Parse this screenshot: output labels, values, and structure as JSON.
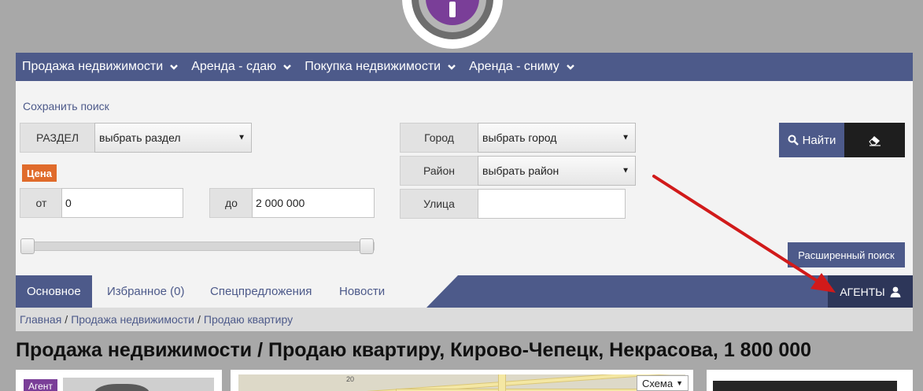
{
  "nav": {
    "items": [
      {
        "label": "Продажа недвижимости"
      },
      {
        "label": "Аренда - сдаю"
      },
      {
        "label": "Покупка недвижимости"
      },
      {
        "label": "Аренда - сниму"
      }
    ]
  },
  "search": {
    "save_link": "Сохранить поиск",
    "section_label": "РАЗДЕЛ",
    "section_value": "выбрать раздел",
    "city_label": "Город",
    "city_value": "выбрать город",
    "district_label": "Район",
    "district_value": "выбрать район",
    "street_label": "Улица",
    "street_value": "",
    "price_label": "Цена",
    "from_label": "от",
    "from_value": "0",
    "to_label": "до",
    "to_value": "2 000 000",
    "find_label": "Найти",
    "advanced_label": "Расширенный поиск"
  },
  "tabs": {
    "items": [
      {
        "label": "Основное"
      },
      {
        "label": "Избранное (0)"
      },
      {
        "label": "Спецпредложения"
      },
      {
        "label": "Новости"
      }
    ],
    "agents_label": "АГЕНТЫ"
  },
  "breadcrumb": {
    "items": [
      "Главная",
      "Продажа недвижимости",
      "Продаю квартиру"
    ],
    "separator": "/"
  },
  "page": {
    "title": "Продажа недвижимости / Продаю квартиру, Кирово-Чепецк, Некрасова, 1 800 000"
  },
  "cards": {
    "agent_badge": "Агент",
    "map_select": "Схема",
    "map_number": "20"
  },
  "colors": {
    "accent": "#4d5a8a",
    "price_tag": "#e06b2b",
    "agent_badge": "#7a3e98",
    "annotation_arrow": "#d11a1a"
  }
}
